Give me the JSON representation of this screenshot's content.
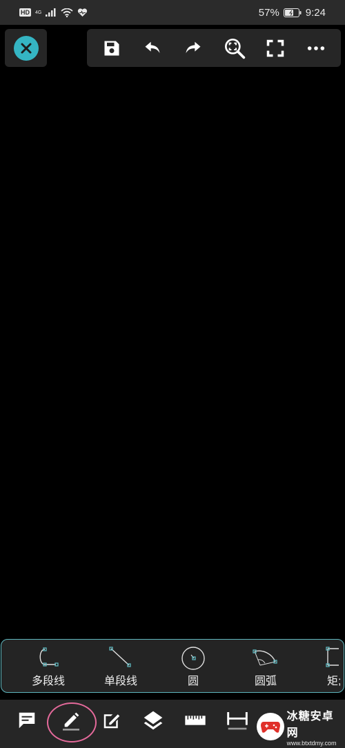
{
  "status_bar": {
    "hd": "HD",
    "network": "4G",
    "battery": "57%",
    "time": "9:24"
  },
  "toolbar": {
    "close": "close-icon",
    "buttons": [
      "save-icon",
      "undo-icon",
      "redo-icon",
      "zoom-extents-icon",
      "fullscreen-icon",
      "more-icon"
    ]
  },
  "shapes": {
    "items": [
      {
        "label": "多段线",
        "icon": "polyline-icon"
      },
      {
        "label": "单段线",
        "icon": "line-icon"
      },
      {
        "label": "圆",
        "icon": "circle-icon"
      },
      {
        "label": "圆弧",
        "icon": "arc-icon"
      },
      {
        "label": "矩;",
        "icon": "rectangle-icon"
      }
    ]
  },
  "bottom_nav": {
    "items": [
      "comment-icon",
      "pencil-icon",
      "edit-icon",
      "layers-icon",
      "ruler-icon",
      "dimension-icon"
    ],
    "active": "pencil-icon"
  },
  "watermark": {
    "title": "冰糖安卓网",
    "url": "www.btxtdmy.com"
  },
  "colors": {
    "accent": "#35b5c3",
    "border": "#5fb7bf",
    "active_ring": "#e56a9b",
    "panel": "#262626"
  }
}
